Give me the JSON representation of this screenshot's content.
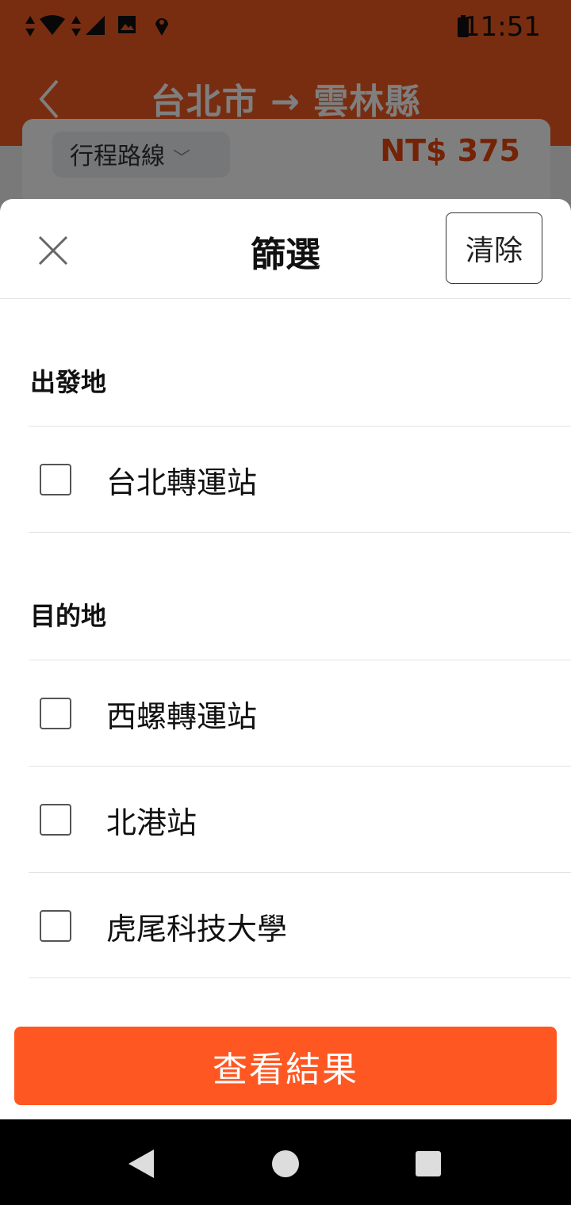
{
  "status_bar": {
    "time": "11:51"
  },
  "app_bar": {
    "title": "台北市 → 雲林縣"
  },
  "result_card": {
    "route_chip_label": "行程路線",
    "price": "NT$ 375"
  },
  "filter_sheet": {
    "title": "篩選",
    "clear_label": "清除",
    "sections": [
      {
        "title": "出發地",
        "options": [
          {
            "label": "台北轉運站",
            "checked": false
          }
        ]
      },
      {
        "title": "目的地",
        "options": [
          {
            "label": "西螺轉運站",
            "checked": false
          },
          {
            "label": "北港站",
            "checked": false
          },
          {
            "label": "虎尾科技大學",
            "checked": false
          }
        ]
      }
    ],
    "submit_label": "查看結果"
  },
  "colors": {
    "brand": "#f15a22",
    "primary_button": "#ff5722",
    "price": "#e8470e"
  }
}
